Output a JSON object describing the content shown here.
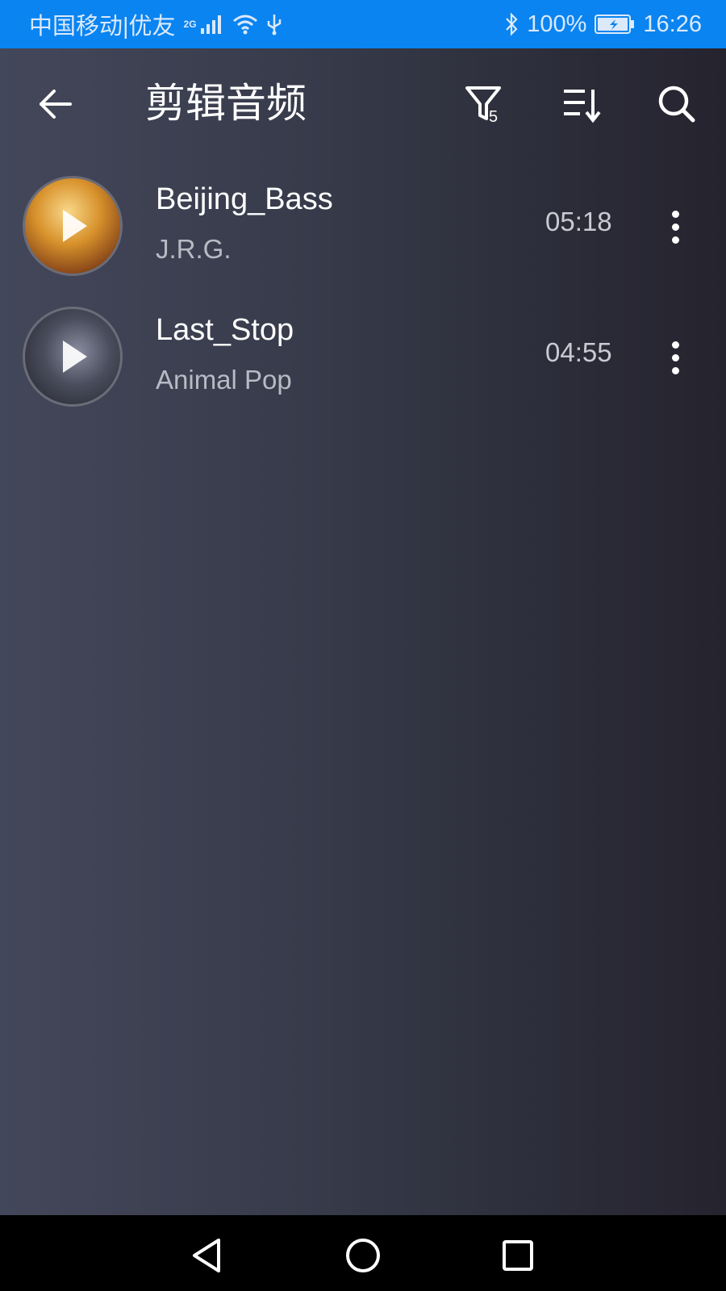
{
  "status_bar": {
    "carrier": "中国移动|优友",
    "network": "2G",
    "battery": "100%",
    "time": "16:26"
  },
  "toolbar": {
    "title": "剪辑音频",
    "filter_badge": "5",
    "icons": [
      "back-arrow-icon",
      "filter-icon",
      "sort-icon",
      "search-icon"
    ]
  },
  "songs": [
    {
      "title": "Beijing_Bass",
      "artist": "J.R.G.",
      "duration": "05:18"
    },
    {
      "title": "Last_Stop",
      "artist": "Animal Pop",
      "duration": "04:55"
    }
  ],
  "nav_bar": {
    "icons": [
      "nav-back-icon",
      "nav-home-icon",
      "nav-recents-icon"
    ]
  },
  "colors": {
    "status_bar_bg": "#0a84f0",
    "background_start": "#43475a",
    "background_end": "#25232e",
    "text_primary": "#ffffff",
    "text_secondary": "#b8bac4"
  }
}
